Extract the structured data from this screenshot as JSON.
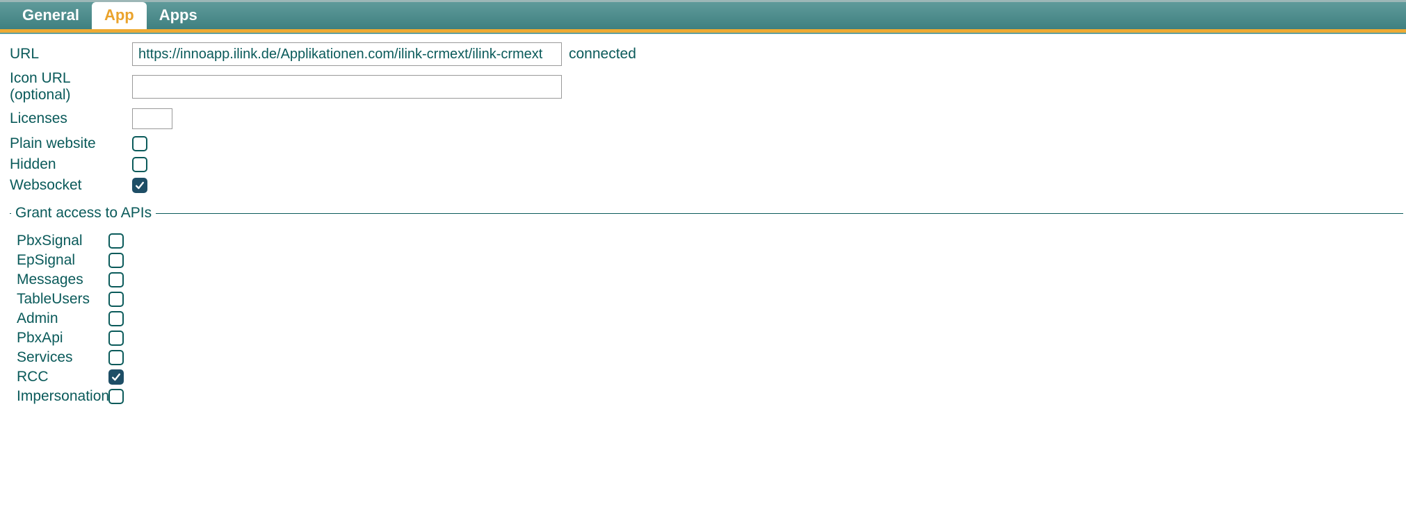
{
  "tabs": {
    "general": "General",
    "app": "App",
    "apps": "Apps"
  },
  "form": {
    "url": {
      "label": "URL",
      "value": "https://innoapp.ilink.de/Applikationen.com/ilink-crmext/ilink-crmext",
      "status": "connected"
    },
    "icon_url": {
      "label": "Icon URL (optional)",
      "value": ""
    },
    "licenses": {
      "label": "Licenses",
      "value": ""
    },
    "plain_website": {
      "label": "Plain website",
      "checked": false
    },
    "hidden": {
      "label": "Hidden",
      "checked": false
    },
    "websocket": {
      "label": "Websocket",
      "checked": true
    }
  },
  "apis": {
    "legend": "Grant access to APIs",
    "items": [
      {
        "label": "PbxSignal",
        "checked": false
      },
      {
        "label": "EpSignal",
        "checked": false
      },
      {
        "label": "Messages",
        "checked": false
      },
      {
        "label": "TableUsers",
        "checked": false
      },
      {
        "label": "Admin",
        "checked": false
      },
      {
        "label": "PbxApi",
        "checked": false
      },
      {
        "label": "Services",
        "checked": false
      },
      {
        "label": "RCC",
        "checked": true
      },
      {
        "label": "Impersonation",
        "checked": false
      }
    ]
  }
}
